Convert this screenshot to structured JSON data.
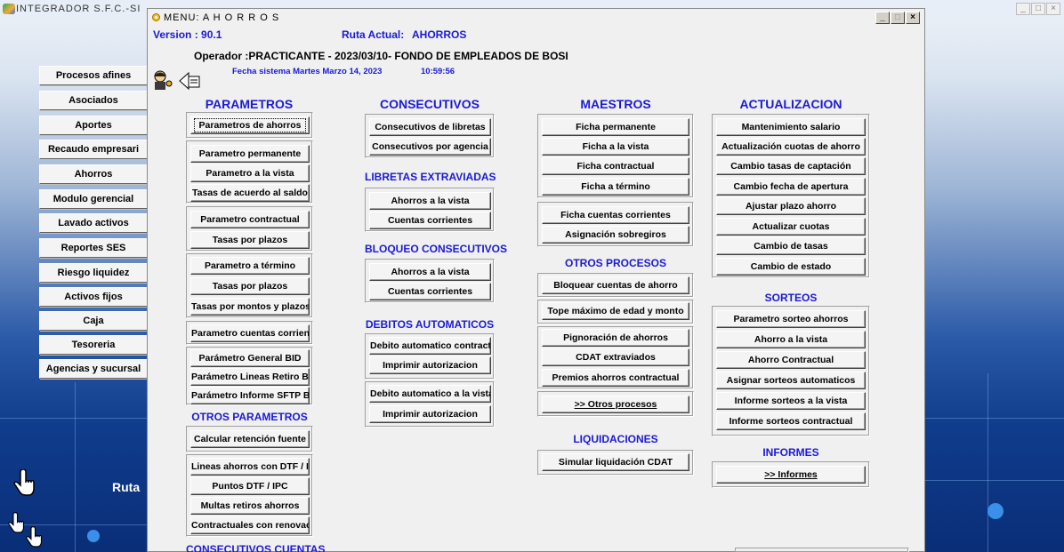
{
  "outer_window": {
    "title": "INTEGRADOR S.F.C.-SI",
    "min": "_",
    "max": "□",
    "close": "×"
  },
  "left_nav": {
    "items": [
      "Procesos afines",
      "Asociados",
      "Aportes",
      "Recaudo empresari",
      "Ahorros",
      "Modulo gerencial",
      "Lavado activos",
      "Reportes SES",
      "Riesgo liquidez",
      "Activos fijos",
      "Caja",
      "Tesoreria",
      "Agencias y sucursal"
    ]
  },
  "background_label": "Ruta",
  "inner_window": {
    "title": "MENU: A H O R R O S",
    "min": "_",
    "max": "□",
    "close": "×"
  },
  "header": {
    "version": "Version : 90.1",
    "ruta_label": "Ruta Actual:",
    "ruta_value": "AHORROS",
    "operador": "Operador :PRACTICANTE - 2023/03/10- FONDO DE EMPLEADOS DE BOSI",
    "fecha": "Fecha sistema Martes Marzo 14, 2023",
    "hora": "10:59:56"
  },
  "parametros": {
    "title": "PARAMETROS",
    "g1": [
      "Parametros de ahorros"
    ],
    "g2": [
      "Parametro permanente",
      "Parametro  a la vista",
      "Tasas de acuerdo al saldo"
    ],
    "g3": [
      "Parametro  contractual",
      "Tasas por plazos"
    ],
    "g4": [
      "Parametro  a  término",
      "Tasas por plazos",
      "Tasas por montos y plazos"
    ],
    "g5": [
      "Parametro  cuentas corrientes"
    ],
    "g6": [
      "Parámetro General BID",
      "Parámetro Lineas  Retiro BID",
      "Parámetro Informe SFTP BID"
    ]
  },
  "otros_parametros": {
    "title": "OTROS PARAMETROS",
    "g1": [
      "Calcular retención fuente"
    ],
    "g2": [
      "Lineas ahorros con DTF / IPC",
      "Puntos  DTF / IPC",
      "Multas retiros ahorros",
      "Contractuales con renovación"
    ]
  },
  "consecutivos_cuentas": {
    "title": "CONSECUTIVOS CUENTAS"
  },
  "consecutivos": {
    "title": "CONSECUTIVOS",
    "items": [
      "Consecutivos de libretas",
      "Consecutivos por agencia"
    ]
  },
  "libretas": {
    "title": "LIBRETAS EXTRAVIADAS",
    "items": [
      "Ahorros a la vista",
      "Cuentas corrientes"
    ]
  },
  "bloqueo": {
    "title": "BLOQUEO CONSECUTIVOS",
    "items": [
      "Ahorros a la vista",
      "Cuentas corrientes"
    ]
  },
  "debitos": {
    "title": "DEBITOS AUTOMATICOS",
    "g1": [
      "Debito automatico contractual",
      "Imprimir autorizacion"
    ],
    "g2": [
      "Debito automatico  a la vista",
      "Imprimir autorizacion"
    ]
  },
  "maestros": {
    "title": "MAESTROS",
    "g1": [
      "Ficha permanente",
      "Ficha a la vista",
      "Ficha contractual",
      "Ficha a término"
    ],
    "g2": [
      "Ficha cuentas corrientes",
      "Asignación sobregiros"
    ]
  },
  "otros_procesos": {
    "title": "OTROS PROCESOS",
    "g1": [
      "Bloquear cuentas de ahorro"
    ],
    "g2": [
      "Tope máximo de edad y monto"
    ],
    "g3": [
      "Pignoración de ahorros",
      "CDAT extraviados",
      "Premios ahorros contractual"
    ],
    "g4": [
      ">> Otros procesos"
    ]
  },
  "liquidaciones": {
    "title": "LIQUIDACIONES",
    "items": [
      "Simular liquidación CDAT"
    ]
  },
  "actualizacion": {
    "title": "ACTUALIZACION",
    "items": [
      "Mantenimiento salario",
      "Actualización cuotas de ahorro",
      "Cambio tasas de captación",
      "Cambio fecha de apertura",
      "Ajustar plazo ahorro",
      "Actualizar cuotas",
      "Cambio de tasas",
      "Cambio de estado"
    ]
  },
  "sorteos": {
    "title": "SORTEOS",
    "items": [
      "Parametro sorteo ahorros",
      "Ahorro a la vista",
      "Ahorro Contractual",
      "Asignar sorteos automaticos",
      "Informe sorteos a la vista",
      "Informe sorteos contractual"
    ]
  },
  "informes": {
    "title": "INFORMES",
    "items": [
      ">> Informes"
    ]
  },
  "colors": {
    "heading_blue": "#1a1ad6",
    "window_bg": "#f0f0f0",
    "desktop_blue": "#0a2e78"
  }
}
